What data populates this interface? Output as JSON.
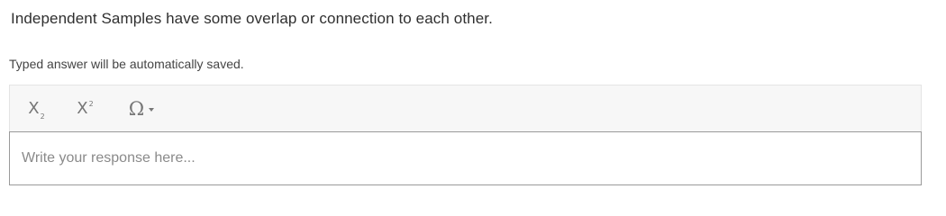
{
  "question": {
    "text": "Independent Samples have some overlap or connection to each other."
  },
  "hint": {
    "text": "Typed answer will be automatically saved."
  },
  "toolbar": {
    "subscript": {
      "icon": "subscript-icon",
      "glyph": "X",
      "mark": "2"
    },
    "superscript": {
      "icon": "superscript-icon",
      "glyph": "X",
      "mark": "2"
    },
    "special_characters": {
      "icon": "omega-icon",
      "glyph": "Ω",
      "dropdown": "chevron-down-icon"
    }
  },
  "response": {
    "value": "",
    "placeholder": "Write your response here..."
  },
  "colors": {
    "toolbar_bg": "#f7f7f7",
    "input_border": "#9a9a9a",
    "icon": "#777777",
    "text": "#2f2f2f"
  }
}
